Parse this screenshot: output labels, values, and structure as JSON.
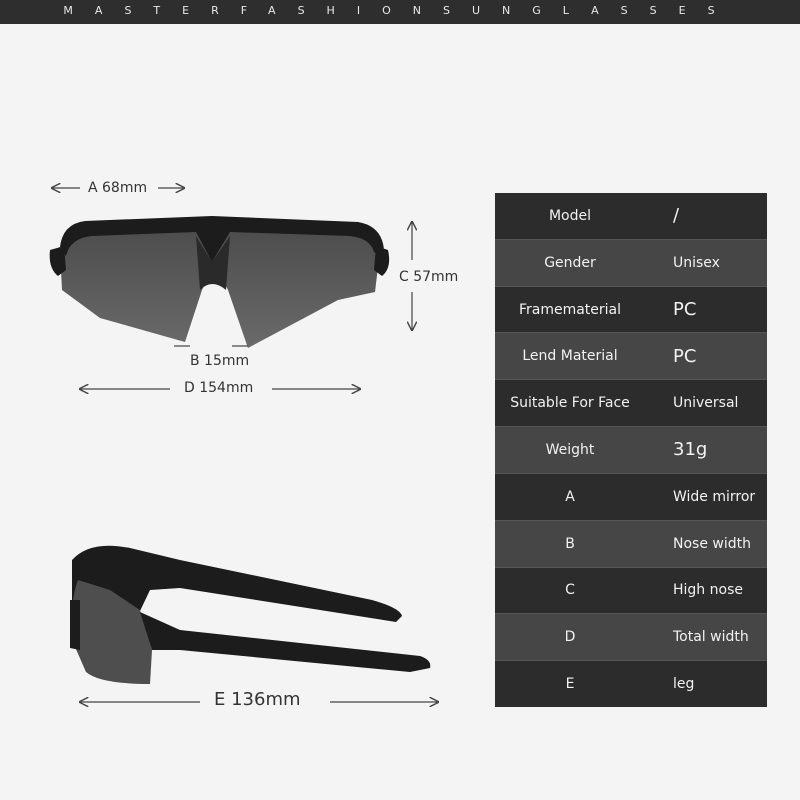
{
  "banner": {
    "text": "MASTERFASHIONSUNGLASSES"
  },
  "dimensions": {
    "a": "A 68mm",
    "b": "B 15mm",
    "c": "C 57mm",
    "d": "D 154mm",
    "e": "E 136mm"
  },
  "specs": [
    {
      "label": "Model",
      "value": "/"
    },
    {
      "label": "Gender",
      "value": "Unisex"
    },
    {
      "label": "Framematerial",
      "value": "PC"
    },
    {
      "label": "Lend Material",
      "value": "PC"
    },
    {
      "label": "Suitable For Face",
      "value": "Universal"
    },
    {
      "label": "Weight",
      "value": "31g"
    },
    {
      "label": "A",
      "value": "Wide mirror"
    },
    {
      "label": "B",
      "value": "Nose width"
    },
    {
      "label": "C",
      "value": "High nose"
    },
    {
      "label": "D",
      "value": "Total width"
    },
    {
      "label": "E",
      "value": "leg"
    }
  ],
  "colors": {
    "banner": "#2e2e2e",
    "table_dark": "#2c2c2c",
    "table_light": "#464646",
    "lens": "#5a5a5a",
    "frame": "#1c1c1c"
  }
}
